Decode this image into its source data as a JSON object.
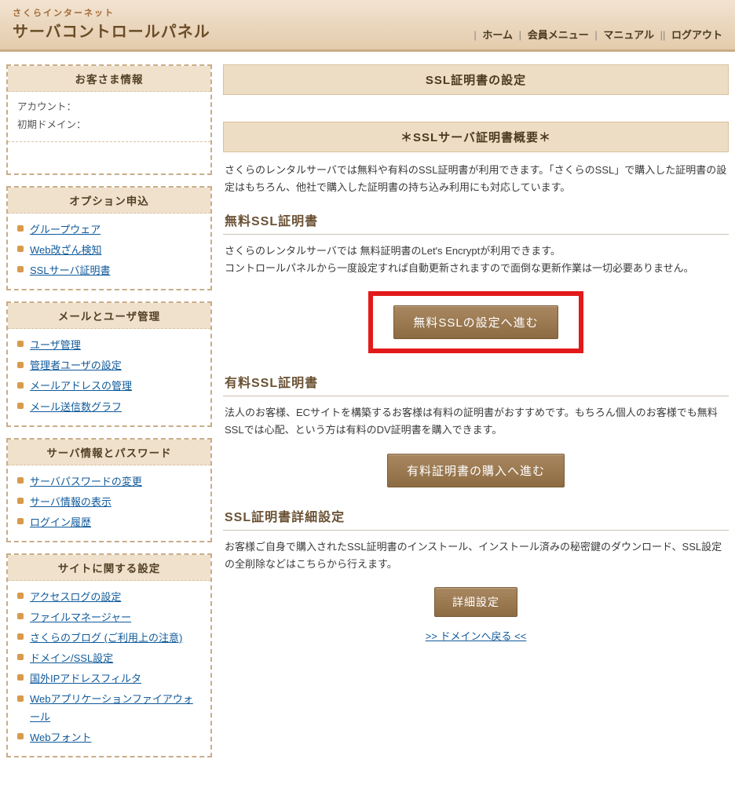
{
  "header": {
    "brand_sub": "さくらインターネット",
    "brand_main": "サーバコントロールパネル",
    "nav": {
      "home": "ホーム",
      "member": "会員メニュー",
      "manual": "マニュアル",
      "logout": "ログアウト"
    }
  },
  "sidebar": {
    "customer": {
      "title": "お客さま情報",
      "account_label": "アカウント：",
      "account_value": "",
      "domain_label": "初期ドメイン：",
      "domain_value": ""
    },
    "option": {
      "title": "オプション申込",
      "items": [
        "グループウェア",
        "Web改ざん検知",
        "SSLサーバ証明書"
      ]
    },
    "mailuser": {
      "title": "メールとユーザ管理",
      "items": [
        "ユーザ管理",
        "管理者ユーザの設定",
        "メールアドレスの管理",
        "メール送信数グラフ"
      ]
    },
    "server": {
      "title": "サーバ情報とパスワード",
      "items": [
        "サーバパスワードの変更",
        "サーバ情報の表示",
        "ログイン履歴"
      ]
    },
    "site": {
      "title": "サイトに関する設定",
      "items": [
        "アクセスログの設定",
        "ファイルマネージャー",
        "さくらのブログ (ご利用上の注意)",
        "ドメイン/SSL設定",
        "国外IPアドレスフィルタ",
        "Webアプリケーションファイアウォール",
        "Webフォント"
      ]
    }
  },
  "main": {
    "page_title": "SSL証明書の設定",
    "overview_title": "＊SSLサーバ証明書概要＊",
    "overview_desc": "さくらのレンタルサーバでは無料や有料のSSL証明書が利用できます。「さくらのSSL」で購入した証明書の設定はもちろん、他社で購入した証明書の持ち込み利用にも対応しています。",
    "free": {
      "heading": "無料SSL証明書",
      "desc1": "さくらのレンタルサーバでは 無料証明書のLet's Encryptが利用できます。",
      "desc2": "コントロールパネルから一度設定すれば自動更新されますので面倒な更新作業は一切必要ありません。",
      "button": "無料SSLの設定へ進む"
    },
    "paid": {
      "heading": "有料SSL証明書",
      "desc": "法人のお客様、ECサイトを構築するお客様は有料の証明書がおすすめです。もちろん個人のお客様でも無料SSLでは心配、という方は有料のDV証明書を購入できます。",
      "button": "有料証明書の購入へ進む"
    },
    "detail": {
      "heading": "SSL証明書詳細設定",
      "desc": "お客様ご自身で購入されたSSL証明書のインストール、インストール済みの秘密鍵のダウンロード、SSL設定の全削除などはこちらから行えます。",
      "button": "詳細設定"
    },
    "backlink": ">> ドメインへ戻る <<"
  }
}
